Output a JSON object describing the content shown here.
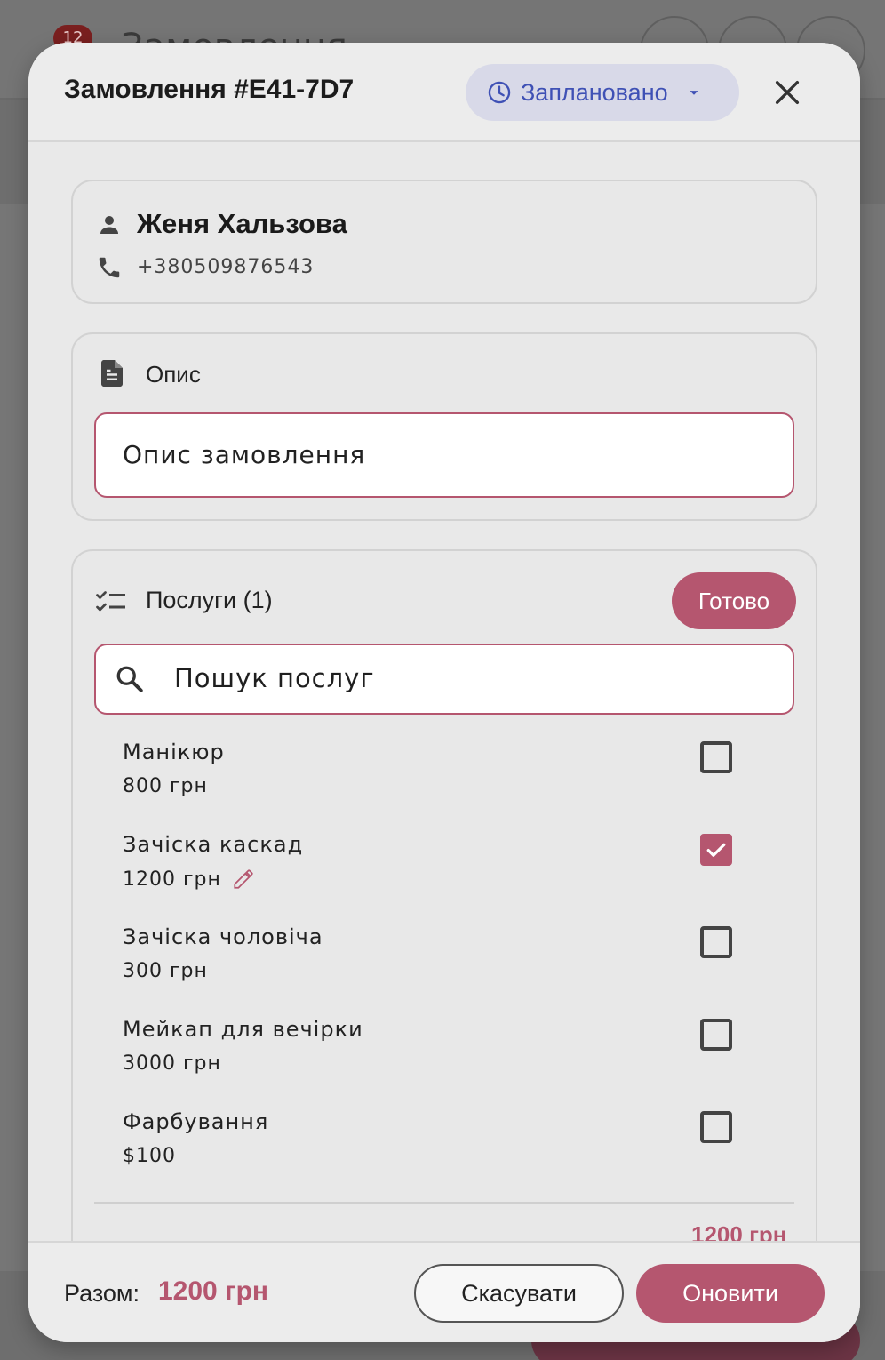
{
  "background": {
    "badge": "12",
    "title": "Замовлення"
  },
  "dialog": {
    "title": "Замовлення #E41-7D7",
    "status": "Заплановано"
  },
  "client": {
    "name": "Женя Хальзова",
    "phone": "+380509876543"
  },
  "description": {
    "label": "Опис",
    "placeholder": "Опис замовлення"
  },
  "services": {
    "label": "Послуги (1)",
    "done_label": "Готово",
    "search_placeholder": "Пошук послуг",
    "items": [
      {
        "name": "Манікюр",
        "price": "800 грн",
        "checked": false
      },
      {
        "name": "Зачіска каскад",
        "price": "1200 грн",
        "checked": true
      },
      {
        "name": "Зачіска чоловіча",
        "price": "300 грн",
        "checked": false
      },
      {
        "name": "Мейкап для вечірки",
        "price": "3000 грн",
        "checked": false
      },
      {
        "name": "Фарбування",
        "price": "$100",
        "checked": false
      }
    ],
    "subtotal": "1200 грн"
  },
  "footer": {
    "total_label": "Разом:",
    "total_value": "1200 грн",
    "cancel_label": "Скасувати",
    "update_label": "Оновити"
  },
  "colors": {
    "accent": "#b5566f",
    "status_chip_bg": "#d8d9e8",
    "status_chip_text": "#3f51b5"
  }
}
